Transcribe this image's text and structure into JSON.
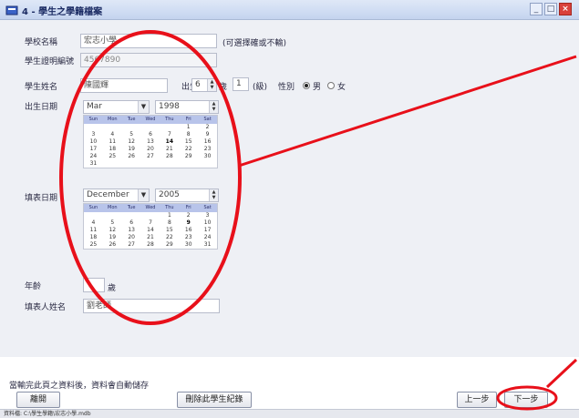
{
  "window": {
    "title": "4 - 學生之學籍檔案",
    "min": "_",
    "max": "□",
    "close": "×"
  },
  "form": {
    "school": {
      "label": "學校名稱",
      "value": "宏志小學",
      "hint": "(可選擇確或不輸)"
    },
    "student_id": {
      "label": "學生證明編號",
      "value": "4567890"
    },
    "name": {
      "label": "學生姓名",
      "value": "陳國輝",
      "age_label": "出生",
      "age_value": "6",
      "age_unit": "歲",
      "grade_value": "1",
      "grade_unit": "(級)",
      "gender_label": "性別",
      "male_label": "男",
      "female_label": "女",
      "selected": "男"
    },
    "birth": {
      "label": "出生日期",
      "month": "Mar",
      "year": "1998",
      "weekdays": [
        "Sun",
        "Mon",
        "Tue",
        "Wed",
        "Thu",
        "Fri",
        "Sat"
      ],
      "days": [
        "",
        "",
        "",
        "",
        "",
        "1",
        "2",
        "3",
        "4",
        "5",
        "6",
        "7",
        "8",
        "9",
        "10",
        "11",
        "12",
        "13",
        "14",
        "15",
        "16",
        "17",
        "18",
        "19",
        "20",
        "21",
        "22",
        "23",
        "24",
        "25",
        "26",
        "27",
        "28",
        "29",
        "30",
        "31",
        "",
        "",
        "",
        "",
        "",
        ""
      ],
      "selected_day": "14"
    },
    "fill": {
      "label": "填表日期",
      "month": "December",
      "year": "2005",
      "weekdays": [
        "Sun",
        "Mon",
        "Tue",
        "Wed",
        "Thu",
        "Fri",
        "Sat"
      ],
      "days": [
        "",
        "",
        "",
        "",
        "1",
        "2",
        "3",
        "4",
        "5",
        "6",
        "7",
        "8",
        "9",
        "10",
        "11",
        "12",
        "13",
        "14",
        "15",
        "16",
        "17",
        "18",
        "19",
        "20",
        "21",
        "22",
        "23",
        "24",
        "25",
        "26",
        "27",
        "28",
        "29",
        "30",
        "31"
      ],
      "selected_day": "9"
    },
    "age": {
      "label": "年齡",
      "value": "",
      "unit": "歲"
    },
    "filler": {
      "label": "填表人姓名",
      "value": "劉老師"
    }
  },
  "footer": {
    "message": "當輸完此頁之資料後，資料會自動儲存",
    "btn_close": "離開",
    "btn_delete": "刪除此學生紀錄",
    "btn_prev": "上一步",
    "btn_next": "下一步"
  },
  "statusbar": {
    "text": "資料檔: C:\\學生學籍\\宏志小學.mdb"
  },
  "colors": {
    "annotation": "#e8101a",
    "titlebar": "#cfdcf3",
    "calendar_header": "#b8c4ea"
  }
}
